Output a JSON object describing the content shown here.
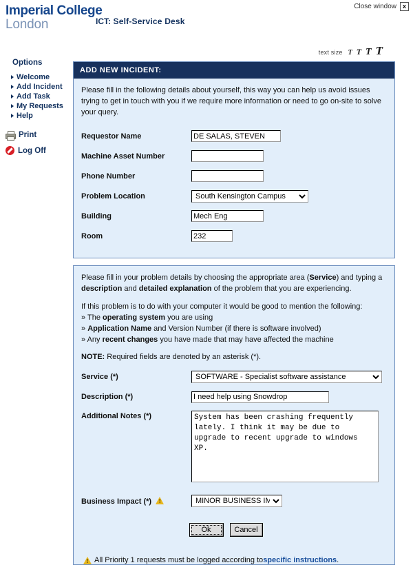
{
  "window": {
    "close_label": "Close window",
    "close_icon": "close-box-icon"
  },
  "branding": {
    "logo_line1": "Imperial College",
    "logo_line2": "London",
    "app_prefix": "ICT:",
    "app_title": "Self-Service Desk",
    "colors": {
      "brand_dark_blue": "#16468c",
      "brand_light_blue": "#7b93b6",
      "header_navy": "#17315d",
      "panel_bg": "#e2eefa",
      "panel_border": "#6e8fbe",
      "link_blue": "#1a4f9c",
      "warning_yellow": "#e8b71d",
      "logoff_red": "#d81f26"
    }
  },
  "text_size": {
    "label": "text size",
    "options": [
      "T",
      "T",
      "T",
      "T"
    ]
  },
  "sidebar": {
    "title": "Options",
    "items": [
      {
        "label": "Welcome"
      },
      {
        "label": "Add Incident"
      },
      {
        "label": "Add Task"
      },
      {
        "label": "My Requests"
      },
      {
        "label": "Help"
      }
    ],
    "actions": [
      {
        "label": "Print",
        "icon": "printer-icon"
      },
      {
        "label": "Log Off",
        "icon": "no-entry-icon"
      }
    ]
  },
  "form": {
    "header": "ADD NEW INCIDENT:",
    "intro": "Please fill in the following details about yourself, this way you can help us avoid issues trying to get in touch with you if we require more information or need to go on-site to solve your query.",
    "fields": {
      "requestor_name": {
        "label": "Requestor Name",
        "value": "DE SALAS, STEVEN"
      },
      "machine_asset_number": {
        "label": "Machine Asset Number",
        "value": ""
      },
      "phone_number": {
        "label": "Phone Number",
        "value": ""
      },
      "problem_location": {
        "label": "Problem Location",
        "value": "South Kensington Campus",
        "options": [
          "South Kensington Campus"
        ]
      },
      "building": {
        "label": "Building",
        "value": "Mech Eng"
      },
      "room": {
        "label": "Room",
        "value": "232"
      }
    }
  },
  "details": {
    "intro_p1_a": "Please fill in your problem details by choosing the appropriate area (",
    "intro_p1_b": "Service",
    "intro_p1_c": ") and typing a ",
    "intro_p1_d": "description",
    "intro_p1_e": " and ",
    "intro_p1_f": "detailed explanation",
    "intro_p1_g": " of the problem that you are experiencing.",
    "intro_p2": "If this problem is to do with your computer it would be good to mention the following:",
    "bullets": [
      {
        "marker": "»",
        "pre": "The ",
        "bold": "operating system",
        "post": " you are using"
      },
      {
        "marker": "»",
        "pre": "",
        "bold": "Application Name",
        "post": " and Version Number (if there is software involved)"
      },
      {
        "marker": "»",
        "pre": "Any ",
        "bold": "recent changes",
        "post": " you have made that may have affected the machine"
      }
    ],
    "note_bold": "NOTE:",
    "note_text": " Required fields are denoted by an asterisk (*).",
    "fields": {
      "service": {
        "label": "Service (*)",
        "value": "SOFTWARE - Specialist software assistance",
        "options": [
          "SOFTWARE - Specialist software assistance"
        ]
      },
      "description": {
        "label": "Description (*)",
        "value": "I need help using Snowdrop"
      },
      "additional_notes": {
        "label": "Additional Notes (*)",
        "value": "System has been crashing frequently lately. I think it may be due to upgrade to recent upgrade to windows XP."
      },
      "business_impact": {
        "label": "Business Impact (*)",
        "value": "MINOR BUSINESS IMPACT",
        "options": [
          "MINOR BUSINESS IMPACT"
        ],
        "warning_icon": "warning-triangle-icon"
      }
    },
    "buttons": {
      "ok": "Ok",
      "cancel": "Cancel"
    },
    "footnote": {
      "icon": "warning-triangle-icon",
      "text_before": "All Priority 1 requests must be logged according to ",
      "link": "specific instructions",
      "text_after": "."
    }
  }
}
